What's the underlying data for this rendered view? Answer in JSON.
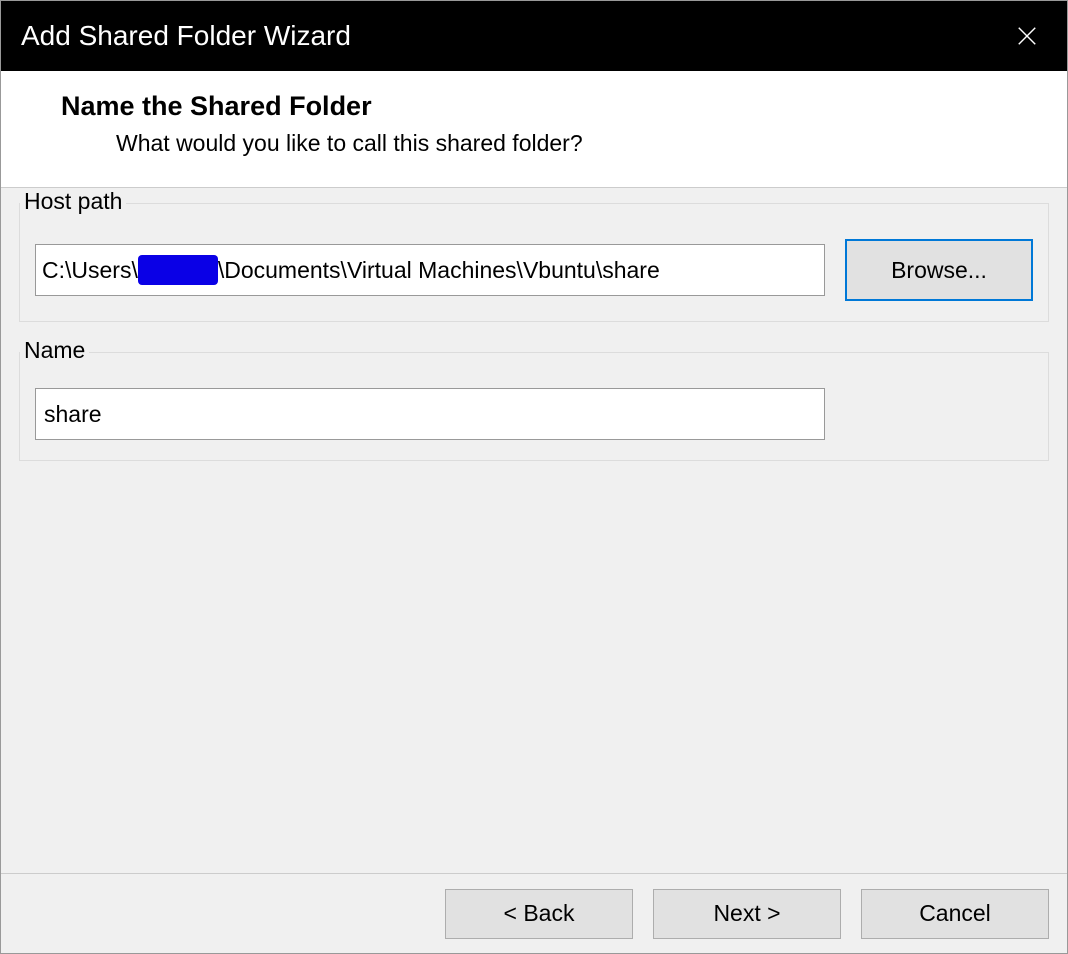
{
  "titlebar": {
    "title": "Add Shared Folder Wizard"
  },
  "header": {
    "title": "Name the Shared Folder",
    "subtitle": "What would you like to call this shared folder?"
  },
  "hostpath": {
    "group_label": "Host path",
    "value_pre": "C:\\Users\\",
    "value_post": "\\Documents\\Virtual Machines\\Vbuntu\\share",
    "browse_label": "Browse..."
  },
  "name": {
    "group_label": "Name",
    "value": "share"
  },
  "footer": {
    "back_label": "< Back",
    "next_label": "Next >",
    "cancel_label": "Cancel"
  }
}
